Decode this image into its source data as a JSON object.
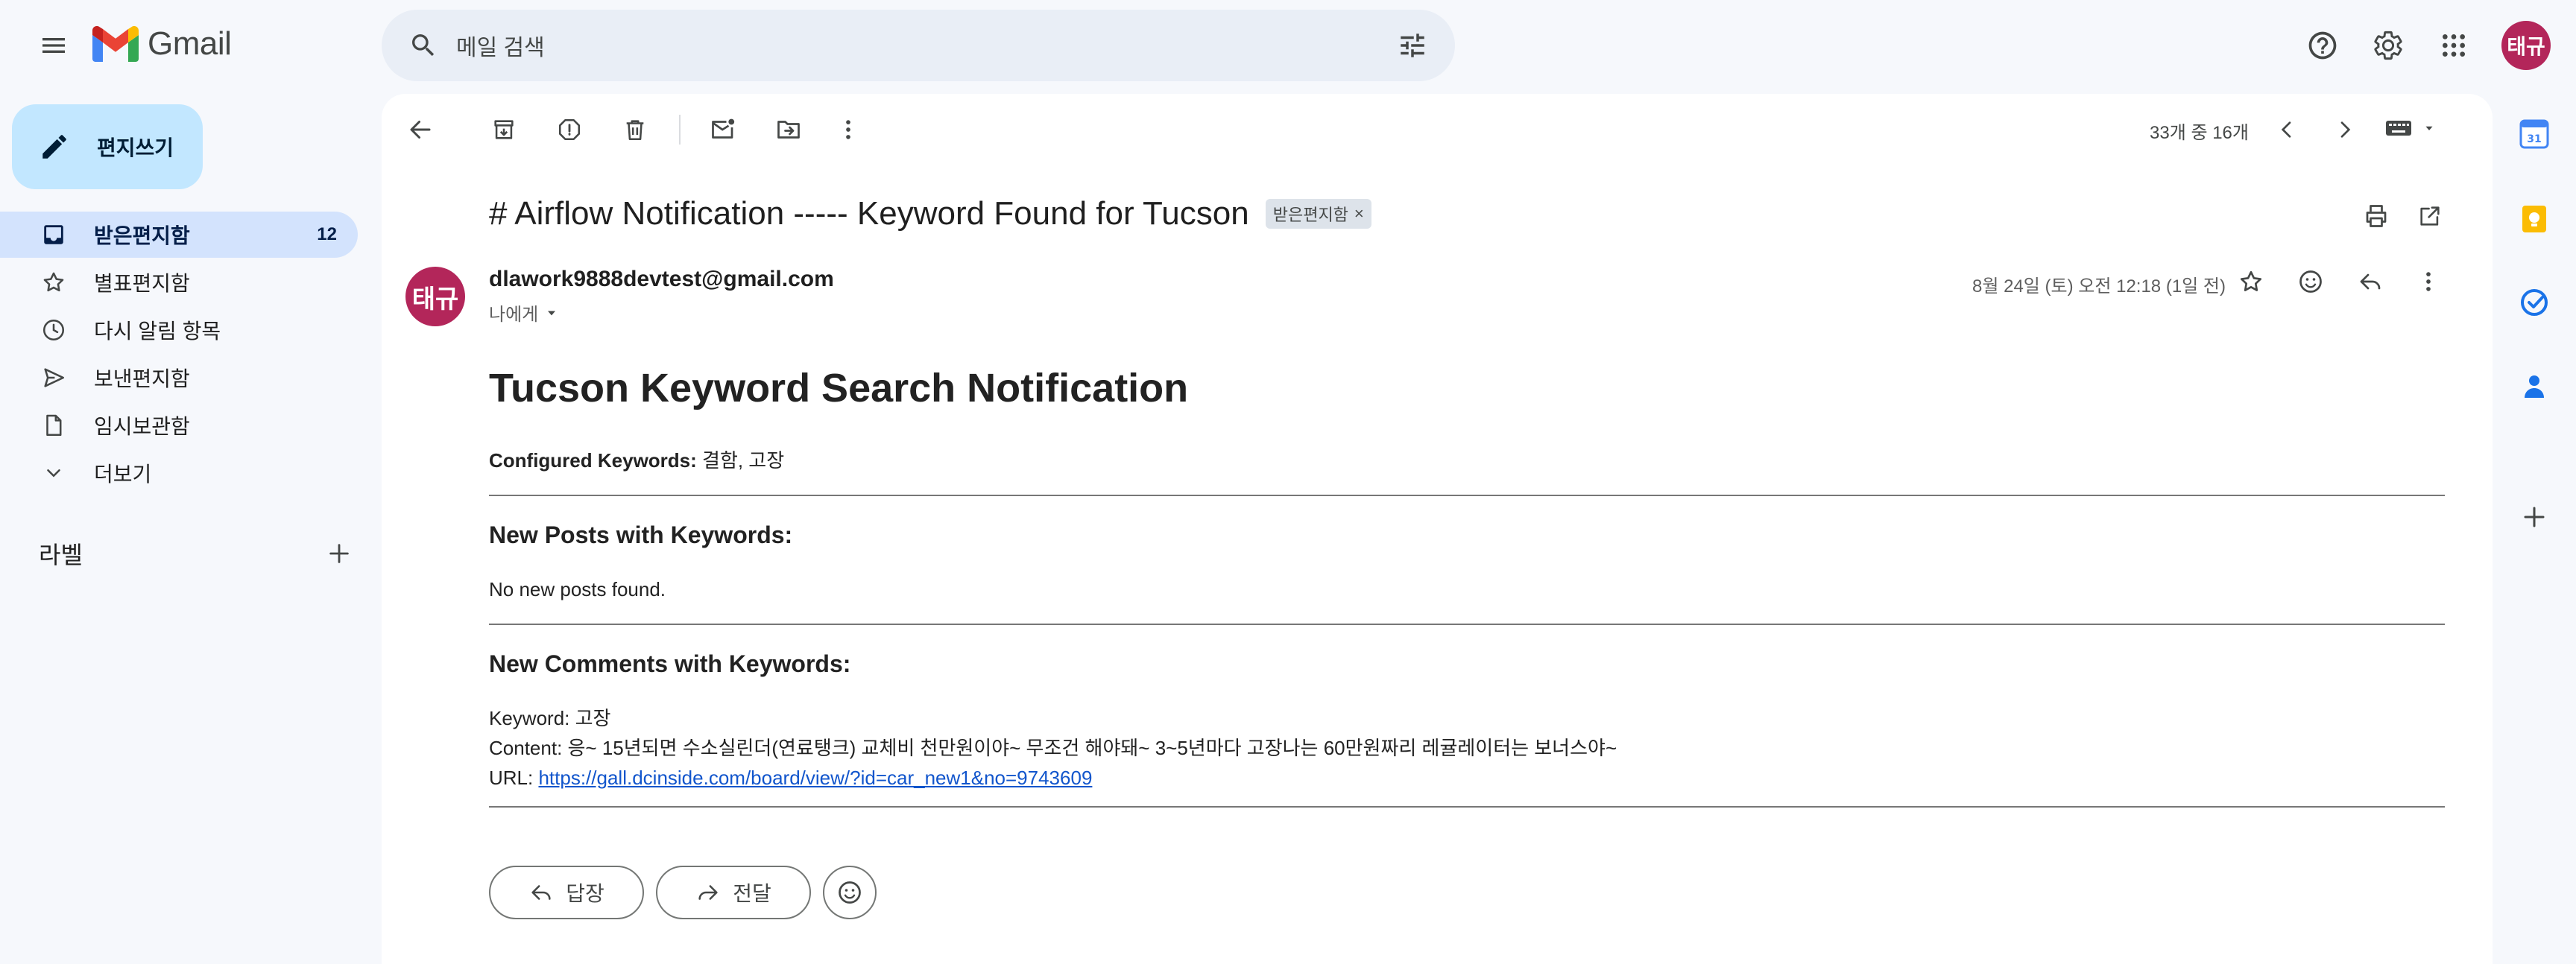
{
  "app": {
    "name": "Gmail",
    "avatar_initials": "태규"
  },
  "search": {
    "placeholder": "메일 검색"
  },
  "compose": {
    "label": "편지쓰기"
  },
  "nav": {
    "items": [
      {
        "label": "받은편지함",
        "count": "12",
        "icon": "inbox-icon",
        "active": true
      },
      {
        "label": "별표편지함",
        "count": "",
        "icon": "star-icon"
      },
      {
        "label": "다시 알림 항목",
        "count": "",
        "icon": "clock-icon"
      },
      {
        "label": "보낸편지함",
        "count": "",
        "icon": "send-icon"
      },
      {
        "label": "임시보관함",
        "count": "",
        "icon": "draft-icon"
      },
      {
        "label": "더보기",
        "count": "",
        "icon": "chevron-down-icon"
      }
    ],
    "labels_title": "라벨"
  },
  "toolbar": {
    "pager": "33개 중 16개"
  },
  "message": {
    "subject": "# Airflow Notification ----- Keyword Found for Tucson",
    "chip_label": "받은편지함",
    "sender_initials": "태규",
    "sender": "dlawork9888devtest@gmail.com",
    "to": "나에게",
    "date": "8월 24일 (토) 오전 12:18 (1일 전)"
  },
  "body": {
    "title": "Tucson Keyword Search Notification",
    "configured_label": "Configured Keywords:",
    "configured_value": " 결함, 고장",
    "posts_heading": "New Posts with Keywords:",
    "posts_text": "No new posts found.",
    "comments_heading": "New Comments with Keywords:",
    "keyword_line": "Keyword: 고장",
    "content_line": "Content: 응~ 15년되면 수소실린더(연료탱크) 교체비 천만원이야~ 무조건 해야돼~ 3~5년마다 고장나는 60만원짜리 레귤레이터는 보너스야~",
    "url_label": "URL: ",
    "url": "https://gall.dcinside.com/board/view/?id=car_new1&no=9743609"
  },
  "actions": {
    "reply": "답장",
    "forward": "전달"
  },
  "colors": {
    "accent": "#0b57d0",
    "avatar": "#b3265a",
    "active_nav": "#d3e3fd",
    "compose": "#c2e7ff"
  }
}
